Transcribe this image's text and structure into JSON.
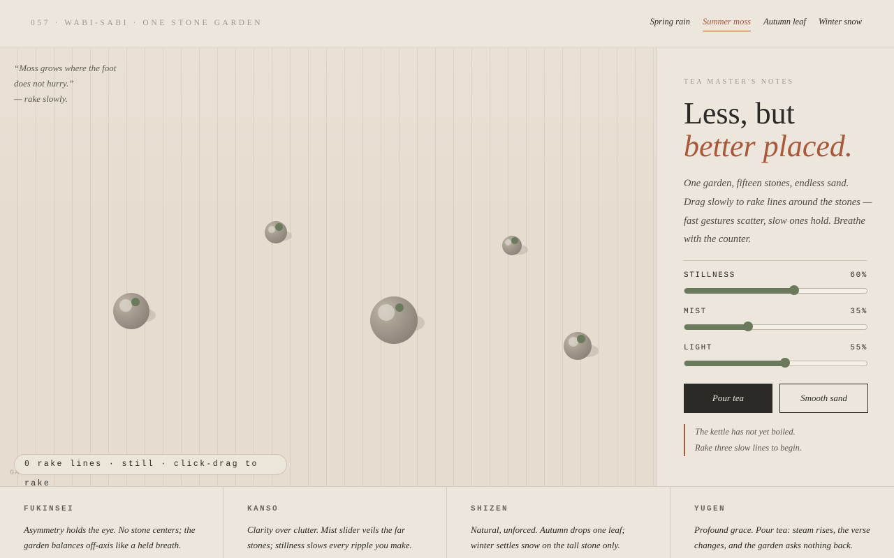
{
  "header": {
    "brand": "057 · WABI-SABI · ONE STONE GARDEN",
    "seasons": [
      {
        "label": "Spring rain",
        "active": false
      },
      {
        "label": "Summer moss",
        "active": true
      },
      {
        "label": "Autumn leaf",
        "active": false
      },
      {
        "label": "Winter snow",
        "active": false
      }
    ]
  },
  "garden": {
    "quote_line1": "“Moss grows where the foot",
    "quote_line2": "does not hurry.”",
    "quote_line3": "— rake slowly.",
    "status": "0 rake lines · still · click-drag to rake",
    "counter": "GARDEN 15 STONES · RAKED 0"
  },
  "panel": {
    "label": "TEA MASTER'S NOTES",
    "headline_1": "Less, but",
    "headline_2": "better placed.",
    "lede": "One garden, fifteen stones, endless sand. Drag slowly to rake lines around the stones — fast gestures scatter, slow ones hold. Breathe with the counter.",
    "sliders": [
      {
        "label": "STILLNESS",
        "value_text": "60%",
        "value": 0.6
      },
      {
        "label": "MIST",
        "value_text": "35%",
        "value": 0.35
      },
      {
        "label": "LIGHT",
        "value_text": "55%",
        "value": 0.55
      }
    ],
    "buttons": {
      "pour": "Pour tea",
      "smooth": "Smooth sand"
    },
    "message_line1": "The kettle has not yet boiled.",
    "message_line2": "Rake three slow lines to begin."
  },
  "principles": [
    {
      "title": "FUKINSEI",
      "text": "Asymmetry holds the eye. No stone centers; the garden balances off-axis like a held breath."
    },
    {
      "title": "KANSO",
      "text": "Clarity over clutter. Mist slider veils the far stones; stillness slows every ripple you make."
    },
    {
      "title": "SHIZEN",
      "text": "Natural, unforced. Autumn drops one leaf; winter settles snow on the tall stone only."
    },
    {
      "title": "YUGEN",
      "text": "Profound grace. Pour tea: steam rises, the verse changes, and the garden asks nothing back."
    }
  ],
  "colors": {
    "accent": "#a9583a",
    "moss": "#6b7a5c",
    "ink": "#2b2a26",
    "sand": "#e6ddd0"
  }
}
